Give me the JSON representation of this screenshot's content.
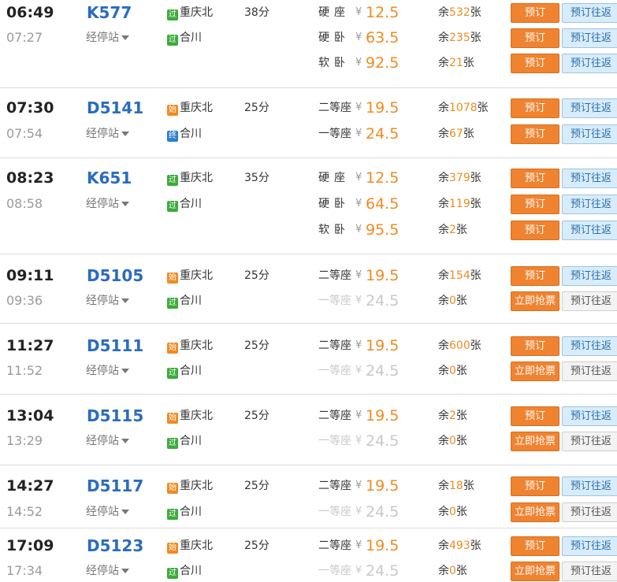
{
  "labels": {
    "via": "经停站",
    "book": "预订",
    "roundtrip": "预订往返",
    "grab": "立即抢票",
    "yen": "¥",
    "rem_prefix": "余",
    "rem_suffix": "张"
  },
  "trains": [
    {
      "dep": "06:49",
      "arr": "07:27",
      "no": "K577",
      "from_badge": "过",
      "from": "重庆北",
      "to_badge": "过",
      "to": "合川",
      "duration": "38分",
      "seats": [
        {
          "type": "硬座",
          "price": "12.5",
          "remain": "532",
          "action": "预订"
        },
        {
          "type": "硬卧",
          "price": "63.5",
          "remain": "235",
          "action": "预订"
        },
        {
          "type": "软卧",
          "price": "92.5",
          "remain": "21",
          "action": "预订"
        }
      ]
    },
    {
      "dep": "07:30",
      "arr": "07:54",
      "no": "D5141",
      "from_badge": "始",
      "from": "重庆北",
      "to_badge": "终",
      "to": "合川",
      "duration": "25分",
      "seats": [
        {
          "type": "二等座",
          "price": "19.5",
          "remain": "1078",
          "action": "预订"
        },
        {
          "type": "一等座",
          "price": "24.5",
          "remain": "67",
          "action": "预订"
        }
      ]
    },
    {
      "dep": "08:23",
      "arr": "08:58",
      "no": "K651",
      "from_badge": "过",
      "from": "重庆北",
      "to_badge": "过",
      "to": "合川",
      "duration": "35分",
      "seats": [
        {
          "type": "硬座",
          "price": "12.5",
          "remain": "379",
          "action": "预订"
        },
        {
          "type": "硬卧",
          "price": "64.5",
          "remain": "119",
          "action": "预订"
        },
        {
          "type": "软卧",
          "price": "95.5",
          "remain": "2",
          "action": "预订"
        }
      ]
    },
    {
      "dep": "09:11",
      "arr": "09:36",
      "no": "D5105",
      "from_badge": "始",
      "from": "重庆北",
      "to_badge": "过",
      "to": "合川",
      "duration": "25分",
      "seats": [
        {
          "type": "二等座",
          "price": "19.5",
          "remain": "154",
          "action": "预订"
        },
        {
          "type": "一等座",
          "price": "24.5",
          "remain": "0",
          "action": "立即抢票"
        }
      ]
    },
    {
      "dep": "11:27",
      "arr": "11:52",
      "no": "D5111",
      "from_badge": "始",
      "from": "重庆北",
      "to_badge": "过",
      "to": "合川",
      "duration": "25分",
      "seats": [
        {
          "type": "二等座",
          "price": "19.5",
          "remain": "600",
          "action": "预订"
        },
        {
          "type": "一等座",
          "price": "24.5",
          "remain": "0",
          "action": "立即抢票"
        }
      ]
    },
    {
      "dep": "13:04",
      "arr": "13:29",
      "no": "D5115",
      "from_badge": "始",
      "from": "重庆北",
      "to_badge": "过",
      "to": "合川",
      "duration": "25分",
      "seats": [
        {
          "type": "二等座",
          "price": "19.5",
          "remain": "2",
          "action": "预订"
        },
        {
          "type": "一等座",
          "price": "24.5",
          "remain": "0",
          "action": "立即抢票"
        }
      ]
    },
    {
      "dep": "14:27",
      "arr": "14:52",
      "no": "D5117",
      "from_badge": "始",
      "from": "重庆北",
      "to_badge": "过",
      "to": "合川",
      "duration": "25分",
      "seats": [
        {
          "type": "二等座",
          "price": "19.5",
          "remain": "18",
          "action": "预订"
        },
        {
          "type": "一等座",
          "price": "24.5",
          "remain": "0",
          "action": "立即抢票"
        }
      ]
    },
    {
      "dep": "17:09",
      "arr": "17:34",
      "no": "D5123",
      "from_badge": "始",
      "from": "重庆北",
      "to_badge": "过",
      "to": "合川",
      "duration": "25分",
      "seats": [
        {
          "type": "二等座",
          "price": "19.5",
          "remain": "493",
          "action": "预订"
        },
        {
          "type": "一等座",
          "price": "24.5",
          "remain": "0",
          "action": "立即抢票"
        }
      ]
    }
  ]
}
